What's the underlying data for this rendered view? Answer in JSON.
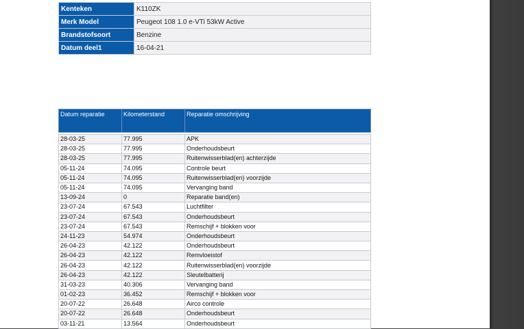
{
  "vehicle": {
    "rows": [
      {
        "label": "Kenteken",
        "value": "K110ZK"
      },
      {
        "label": "Merk Model",
        "value": "Peugeot 108 1.0 e-VTi 53kW Active"
      },
      {
        "label": "Brandstofsoort",
        "value": "Benzine"
      },
      {
        "label": "Datum deel1",
        "value": "16-04-21"
      }
    ]
  },
  "repairs": {
    "headers": [
      "Datum reparatie",
      "Kilometerstand",
      "Reparatie omschrijving"
    ],
    "rows": [
      [
        "28-03-25",
        "77.995",
        "APK"
      ],
      [
        "28-03-25",
        "77.995",
        "Onderhoudsbeurt"
      ],
      [
        "28-03-25",
        "77.995",
        "Ruitenwisserblad(en) achterzijde"
      ],
      [
        "05-11-24",
        "74.095",
        "Controle beurt"
      ],
      [
        "05-11-24",
        "74.095",
        "Ruitenwisserblad(en) voorzijde"
      ],
      [
        "05-11-24",
        "74.095",
        "Vervanging band"
      ],
      [
        "13-09-24",
        "0",
        "Reparatie band(en)"
      ],
      [
        "23-07-24",
        "67.543",
        "Luchtfilter"
      ],
      [
        "23-07-24",
        "67.543",
        "Onderhoudsbeurt"
      ],
      [
        "23-07-24",
        "67.543",
        "Remschijf + blokken voor"
      ],
      [
        "24-11-23",
        "54.974",
        "Onderhoudsbeurt"
      ],
      [
        "26-04-23",
        "42.122",
        "Onderhoudsbeurt"
      ],
      [
        "26-04-23",
        "42.122",
        "Remvloeistof"
      ],
      [
        "26-04-23",
        "42.122",
        "Ruitenwisserblad(en) voorzijde"
      ],
      [
        "26-04-23",
        "42.122",
        "Sleutelbatterij"
      ],
      [
        "31-03-23",
        "40.306",
        "Vervanging band"
      ],
      [
        "01-02-23",
        "36.452",
        "Remschijf + blokken voor"
      ],
      [
        "20-07-22",
        "26.648",
        "Airco controle"
      ],
      [
        "20-07-22",
        "26.648",
        "Onderhoudsbeurt"
      ],
      [
        "03-11-21",
        "13.564",
        "Onderhoudsbeurt"
      ]
    ]
  }
}
